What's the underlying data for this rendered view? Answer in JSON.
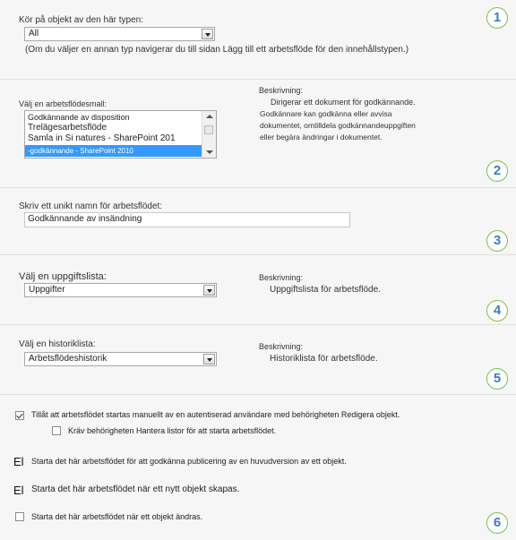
{
  "sections": {
    "type": {
      "label": "Kör på objekt av den här typen:",
      "selected": "All",
      "note": "(Om du väljer en annan typ navigerar du till sidan Lägg till ett arbetsflöde för den innehållstypen.)",
      "badge": "1"
    },
    "template": {
      "label": "Välj en arbetsflödesmall:",
      "items": [
        "Godkännande av disposition",
        "Trelägesarbetsflöde",
        "Samla in Si natures - SharePoint 201",
        "-godkännande - SharePoint 2010"
      ],
      "desc_label": "Beskrivning:",
      "desc_lines": [
        "Dirigerar ett dokument för godkännande.",
        "Godkännare kan godkänna eller avvisa",
        "dokumentet, omtilldela godkännandeuppgiften",
        "eller begära ändringar i dokumentet."
      ],
      "badge": "2"
    },
    "name": {
      "label": "Skriv ett unikt namn för arbetsflödet:",
      "value": "Godkännande av insändning",
      "badge": "3"
    },
    "tasks": {
      "label": "Välj en uppgiftslista:",
      "selected": "Uppgifter",
      "desc_label": "Beskrivning:",
      "desc": "Uppgiftslista för arbetsflöde.",
      "badge": "4"
    },
    "history": {
      "label": "Välj en historiklista:",
      "selected": "Arbetsflödeshistorik",
      "desc_label": "Beskrivning:",
      "desc": "Historiklista för arbetsflöde.",
      "badge": "5"
    },
    "start": {
      "options": [
        {
          "text": "Tillåt att arbetsflödet startas manuellt av en autentiserad användare med behörigheten Redigera objekt.",
          "checked": true
        },
        {
          "text": "Kräv behörigheten Hantera listor för att starta arbetsflödet.",
          "checked": false
        }
      ],
      "publish_prefix": "El",
      "publish_text": "Starta det här arbetsflödet för att godkänna publicering av en huvudversion av ett objekt.",
      "create_prefix": "El",
      "create_text": "Starta det här arbetsflödet när ett nytt objekt skapas.",
      "change_text": "Starta det här arbetsflödet när ett objekt ändras.",
      "badge": "6"
    }
  },
  "colors": {
    "badge_border": "#7cc242",
    "badge_text": "#3d7fbf",
    "list_selected": "#3399ff"
  }
}
